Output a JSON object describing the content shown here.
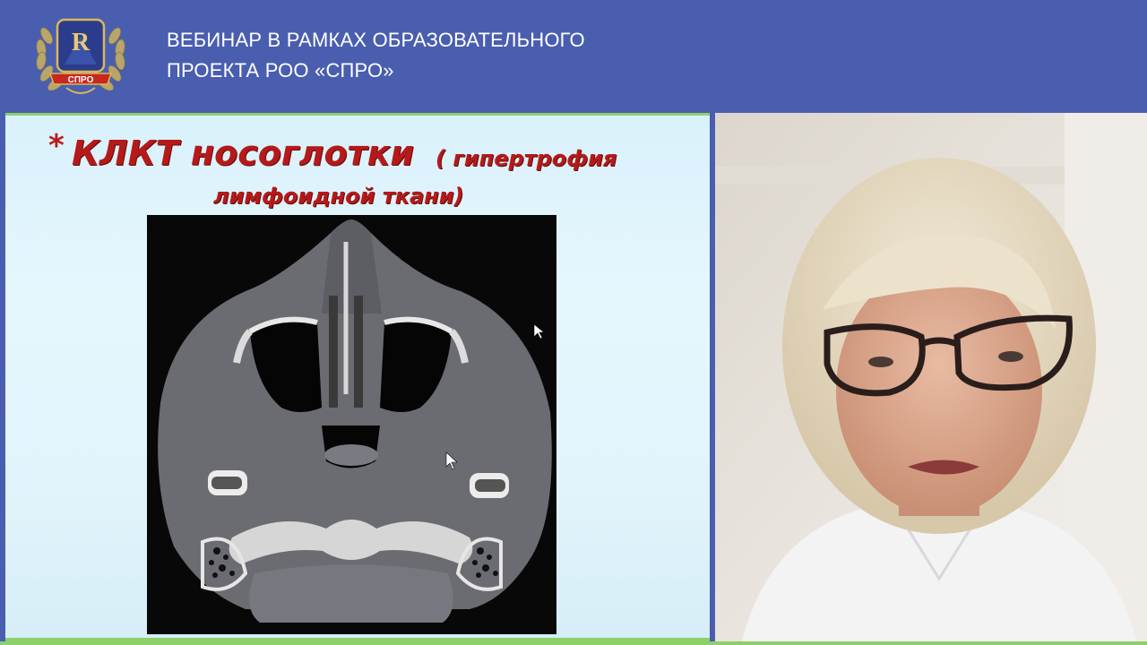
{
  "header": {
    "title_line1": "ВЕБИНАР В РАМКАХ ОБРАЗОВАТЕЛЬНОГО",
    "title_line2": "ПРОЕКТА РОО «СПРО»",
    "logo": {
      "letter": "R",
      "ribbon_text": "СПРО"
    }
  },
  "slide": {
    "bullet": "*",
    "title": "КЛКТ носоглотки",
    "subtitle_line1": "( гипертрофия",
    "subtitle_line2": "лимфоидной ткани)"
  },
  "colors": {
    "header_bg": "#4a5eb0",
    "slide_title": "#b51a1a",
    "slide_border": "#8dd06a"
  },
  "icons": [
    "laurel-logo-icon",
    "mouse-cursor-icon"
  ]
}
